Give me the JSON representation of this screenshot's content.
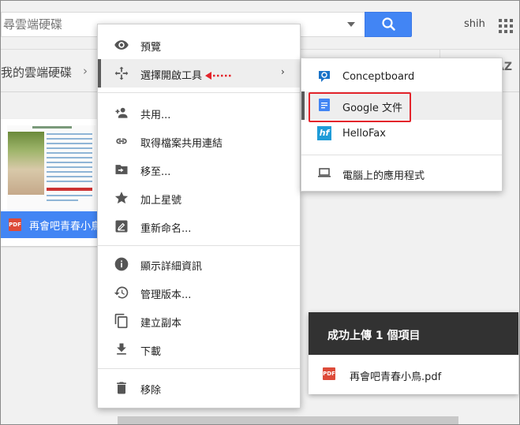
{
  "search": {
    "placeholder": "尋雲端硬碟"
  },
  "header": {
    "user": "shih"
  },
  "breadcrumb": {
    "label": "我的雲端硬碟",
    "chevron": "›"
  },
  "sort": {
    "label": "AZ"
  },
  "file": {
    "name": "再會吧青春小鳥",
    "type_badge": "PDF"
  },
  "context_menu": {
    "preview": "預覽",
    "open_with": "選擇開啟工具",
    "share": "共用...",
    "get_link": "取得檔案共用連結",
    "move_to": "移至...",
    "star": "加上星號",
    "rename": "重新命名...",
    "details": "顯示詳細資訊",
    "versions": "管理版本...",
    "copy": "建立副本",
    "download": "下載",
    "remove": "移除",
    "submenu_arrow": "›"
  },
  "submenu": {
    "conceptboard": "Conceptboard",
    "google_docs": "Google 文件",
    "hellofax": "HelloFax",
    "hellofax_badge": "hf",
    "desktop_app": "電腦上的應用程式"
  },
  "toast": {
    "title": "成功上傳 1 個項目",
    "file_name": "再會吧青春小鳥.pdf",
    "file_badge": "PDF"
  },
  "colors": {
    "accent": "#4285f4",
    "highlight": "#e3242b",
    "pdf": "#dd4b39",
    "toast_bg": "#323232"
  }
}
